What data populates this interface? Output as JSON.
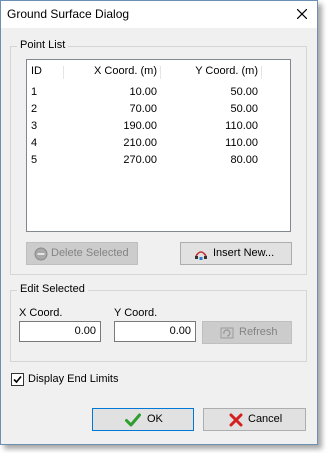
{
  "dialog": {
    "title": "Ground Surface Dialog"
  },
  "point_list": {
    "group_title": "Point List",
    "columns": [
      "ID",
      "X Coord. (m)",
      "Y Coord. (m)"
    ],
    "rows": [
      [
        "1",
        "10.00",
        "50.00"
      ],
      [
        "2",
        "70.00",
        "50.00"
      ],
      [
        "3",
        "190.00",
        "110.00"
      ],
      [
        "4",
        "210.00",
        "110.00"
      ],
      [
        "5",
        "270.00",
        "80.00"
      ]
    ],
    "delete_label": "Delete Selected",
    "insert_label": "Insert New..."
  },
  "edit_selected": {
    "group_title": "Edit Selected",
    "x_label": "X Coord.",
    "y_label": "Y Coord.",
    "x_value": "0.00",
    "y_value": "0.00",
    "refresh_label": "Refresh"
  },
  "display_end_limits": {
    "label": "Display End Limits",
    "checked": true
  },
  "footer": {
    "ok_label": "OK",
    "cancel_label": "Cancel"
  },
  "colors": {
    "ok_check": "#2e9e2e",
    "cancel_x": "#d42020",
    "window_border": "#6d8fb3"
  }
}
